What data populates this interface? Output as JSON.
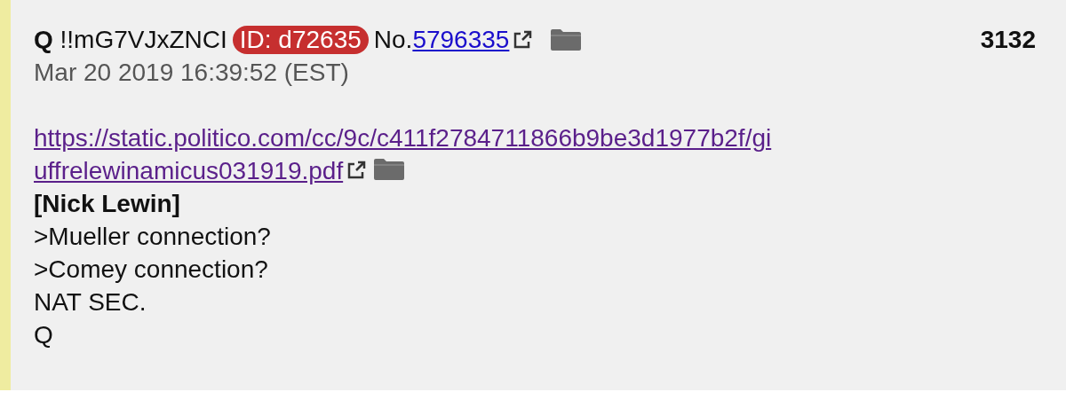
{
  "post": {
    "author": "Q",
    "tripcode": "!!mG7VJxZNCI",
    "id_badge": "ID: d72635",
    "number_prefix": "No.",
    "number": "5796335",
    "index": "3132",
    "timestamp": "Mar 20 2019 16:39:52 (EST)",
    "lines": [
      {
        "kind": "link",
        "text": "https://static.politico.com/cc/9c/c411f2784711866b9be3d1977b2f/gi"
      },
      {
        "kind": "link_end",
        "text": "uffrelewinamicus031919.pdf"
      },
      {
        "kind": "bold",
        "text": "[Nick Lewin]"
      },
      {
        "kind": "text",
        "text": ">Mueller connection?"
      },
      {
        "kind": "text",
        "text": ">Comey connection?"
      },
      {
        "kind": "text",
        "text": "NAT SEC."
      },
      {
        "kind": "text",
        "text": "Q"
      }
    ]
  }
}
